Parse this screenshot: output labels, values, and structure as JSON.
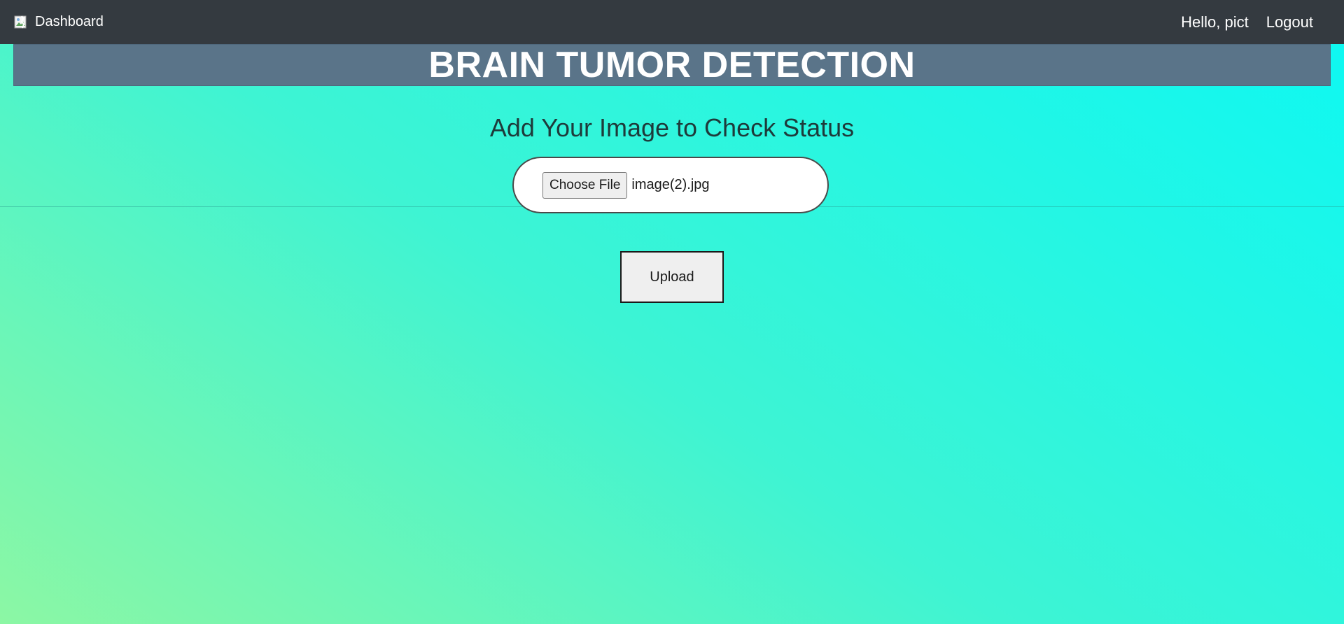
{
  "navbar": {
    "brand_label": "Dashboard",
    "brand_icon": "broken-image-icon",
    "greeting": "Hello, pict",
    "logout_label": "Logout",
    "background_color": "#343a40"
  },
  "banner": {
    "title": "BRAIN TUMOR DETECTION",
    "background_color": "#5a7489"
  },
  "main": {
    "heading": "Add Your Image to Check Status",
    "file_input": {
      "button_label": "Choose File",
      "selected_file": "image(2).jpg"
    },
    "upload_label": "Upload"
  },
  "theme": {
    "gradient_start": "#8cf7a4",
    "gradient_end": "#0cf8f3"
  }
}
